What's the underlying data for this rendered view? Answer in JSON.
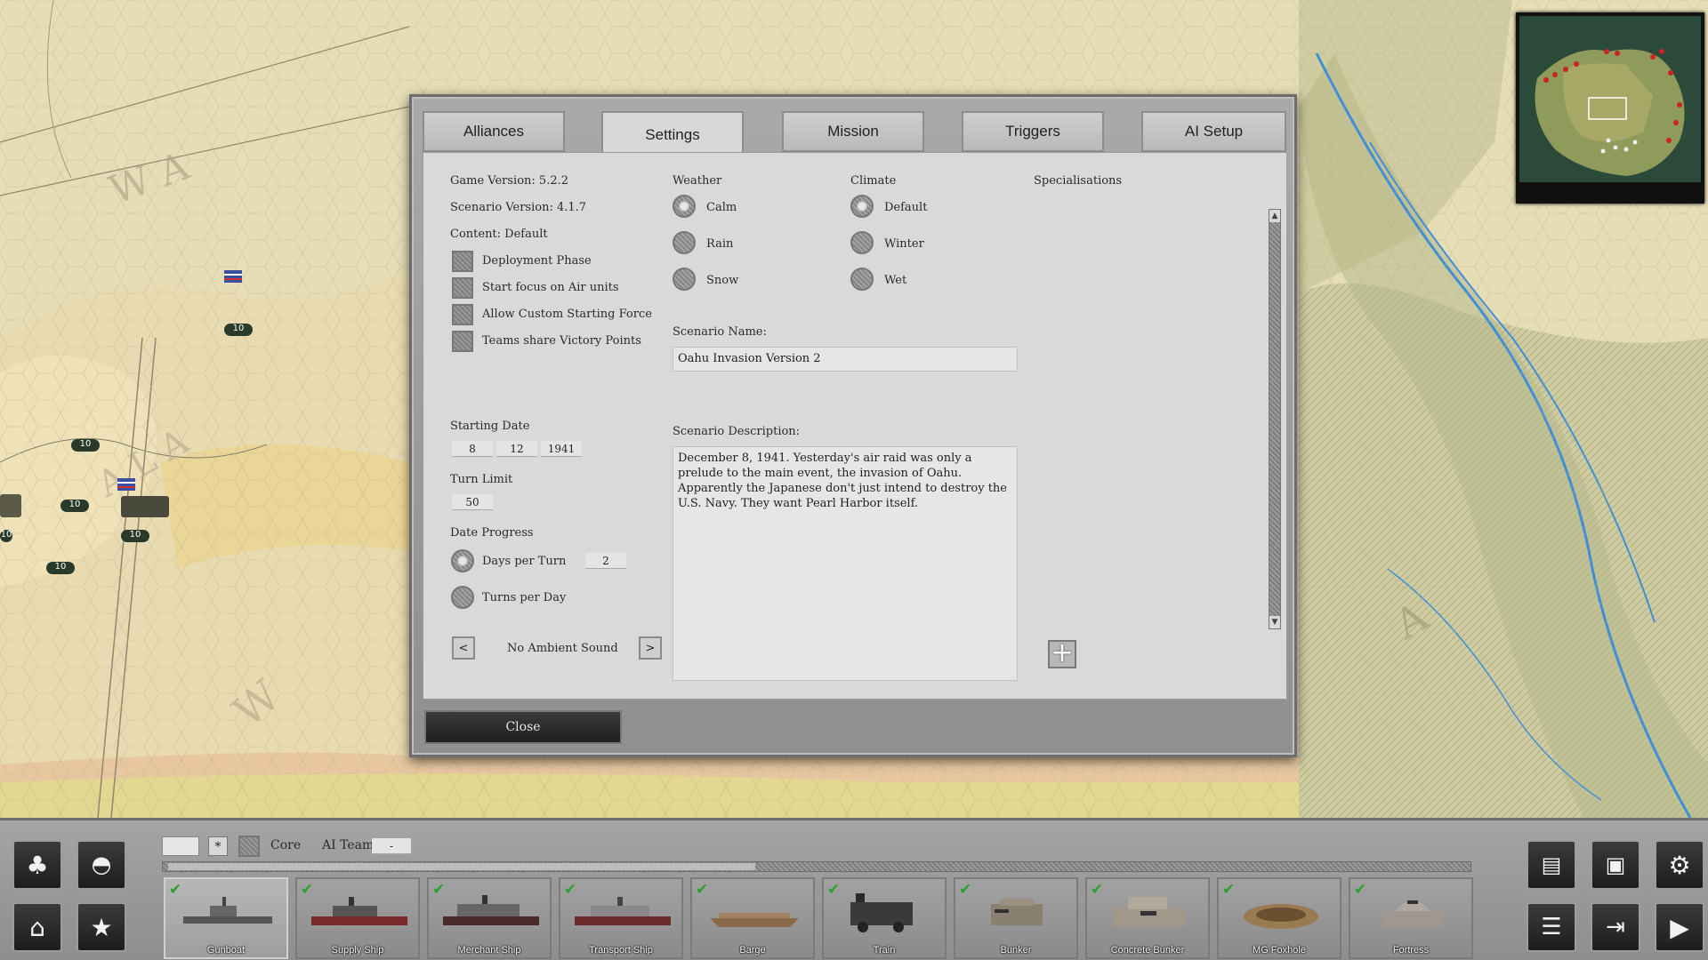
{
  "tabs": [
    "Alliances",
    "Settings",
    "Mission",
    "Triggers",
    "AI Setup"
  ],
  "active_tab": "Settings",
  "settings": {
    "game_version": "Game Version: 5.2.2",
    "scenario_version": "Scenario Version: 4.1.7",
    "content": "Content: Default",
    "options": [
      "Deployment Phase",
      "Start focus on Air units",
      "Allow Custom Starting Force",
      "Teams share Victory Points"
    ],
    "starting_date_label": "Starting Date",
    "date_day": "8",
    "date_month": "12",
    "date_year": "1941",
    "turn_limit_label": "Turn Limit",
    "turn_limit": "50",
    "date_progress_label": "Date Progress",
    "days_per_turn_label": "Days per Turn",
    "days_per_turn": "2",
    "turns_per_day_label": "Turns per Day",
    "ambient_prev": "<",
    "ambient_next": ">",
    "ambient_sound": "No Ambient Sound",
    "weather_label": "Weather",
    "weather_options": [
      "Calm",
      "Rain",
      "Snow"
    ],
    "weather_selected": "Calm",
    "climate_label": "Climate",
    "climate_options": [
      "Default",
      "Winter",
      "Wet"
    ],
    "climate_selected": "Default",
    "specialisations_label": "Specialisations",
    "scenario_name_label": "Scenario Name:",
    "scenario_name": "Oahu Invasion Version 2",
    "scenario_description_label": "Scenario Description:",
    "scenario_description": "December 8, 1941.  Yesterday's air raid was only a prelude to the main event, the invasion of Oahu.  Apparently the Japanese don't just intend to destroy the U.S. Navy.  They want Pearl Harbor itself.",
    "close_label": "Close"
  },
  "toolbar": {
    "star_label": "*",
    "core_label": "Core",
    "ai_team_label": "AI Team",
    "ai_team_value": "-"
  },
  "units": [
    {
      "name": "Gunboat",
      "checked": true,
      "selected": true
    },
    {
      "name": "Supply Ship",
      "checked": true,
      "selected": false
    },
    {
      "name": "Merchant Ship",
      "checked": true,
      "selected": false
    },
    {
      "name": "Transport Ship",
      "checked": true,
      "selected": false
    },
    {
      "name": "Barge",
      "checked": true,
      "selected": false
    },
    {
      "name": "Train",
      "checked": true,
      "selected": false
    },
    {
      "name": "Bunker",
      "checked": true,
      "selected": false
    },
    {
      "name": "Concrete Bunker",
      "checked": true,
      "selected": false
    },
    {
      "name": "MG Foxhole",
      "checked": true,
      "selected": false
    },
    {
      "name": "Fortress",
      "checked": true,
      "selected": false
    }
  ],
  "map_units": {
    "strength_labels": [
      "10",
      "10",
      "10",
      "10",
      "10",
      "10",
      "10"
    ]
  },
  "colors": {
    "map_paper": "#e3d7ad",
    "map_green": "#c9c79a",
    "river": "#3f8fd6",
    "dialog_panel": "#d9d9d9",
    "check_green": "#2e9e2e"
  },
  "icons": [
    "tree-icon",
    "helmet-icon",
    "home-icon",
    "star-icon",
    "document-icon",
    "save-icon",
    "gear-icon",
    "list-icon",
    "exit-icon",
    "play-icon"
  ]
}
